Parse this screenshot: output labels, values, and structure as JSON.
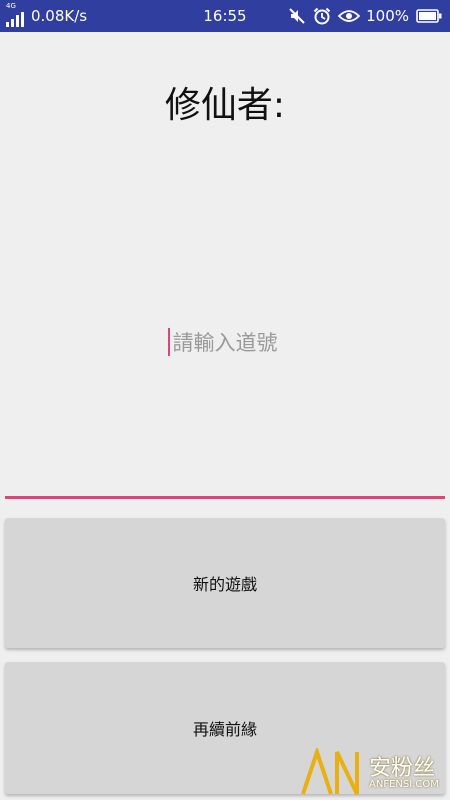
{
  "status_bar": {
    "network": "4G",
    "net_speed": "0.08K/s",
    "time": "16:55",
    "battery": "100%",
    "background_color": "#303f9f",
    "icons": [
      "signal-icon",
      "mute-icon",
      "alarm-icon",
      "eye-icon",
      "battery-icon"
    ]
  },
  "main": {
    "title": "修仙者:",
    "name_input": {
      "placeholder": "請輸入道號",
      "value": ""
    },
    "accent_color": "#e2417a"
  },
  "buttons": {
    "new_game": "新的遊戲",
    "continue_game": "再續前緣"
  },
  "watermark": {
    "logo": "AN",
    "text": "安粉丝",
    "subtext": "ANFENSI.COM"
  }
}
